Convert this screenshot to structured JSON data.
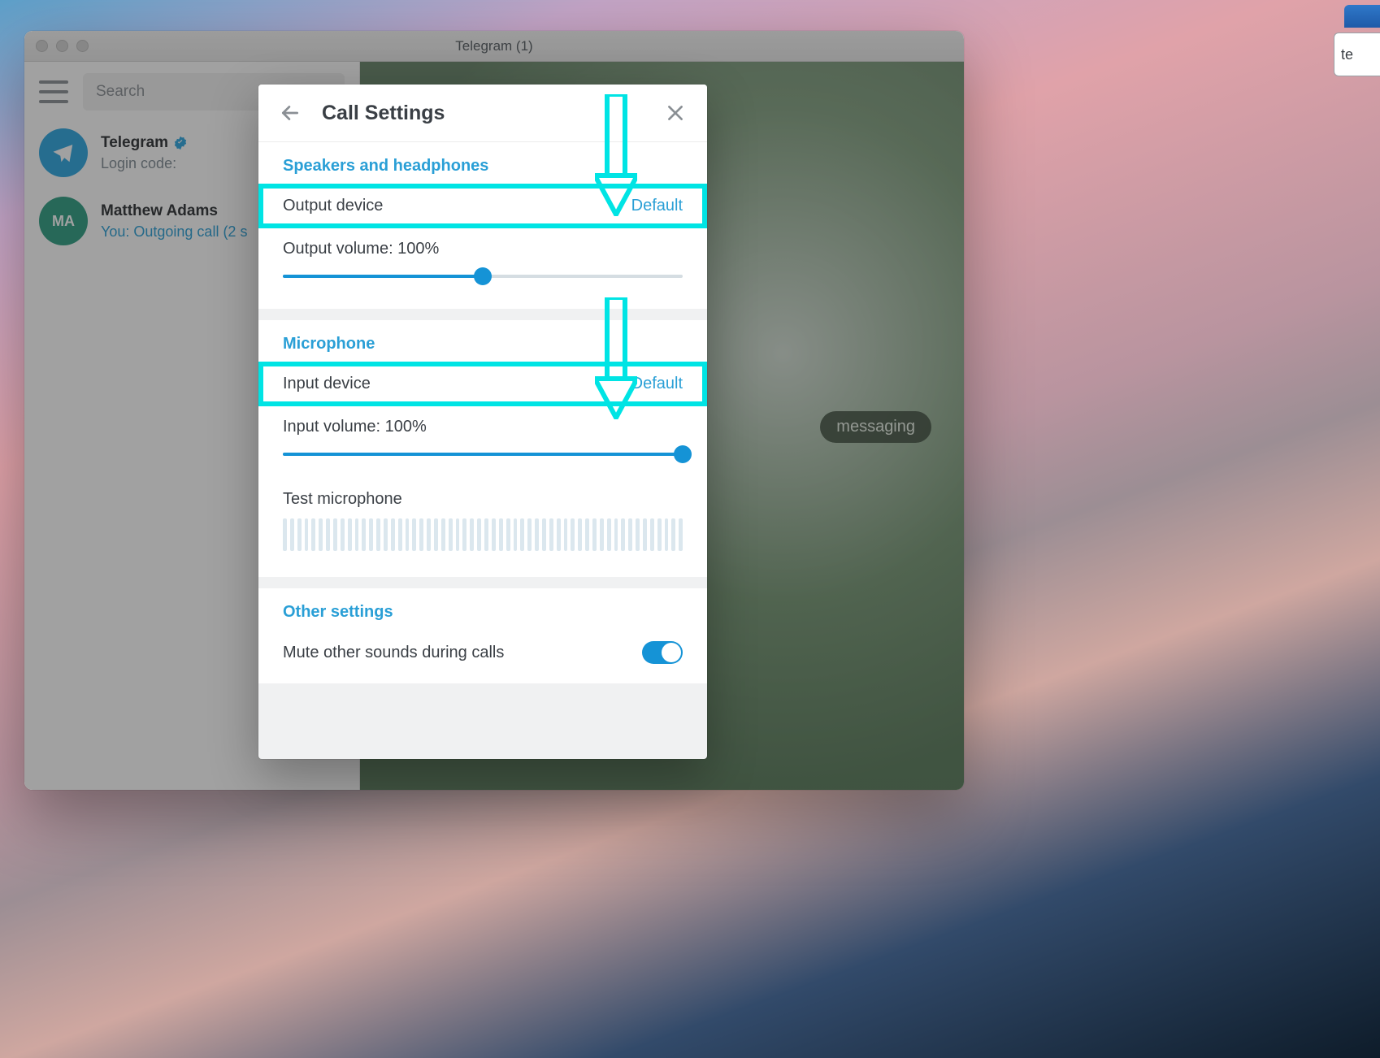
{
  "window": {
    "title": "Telegram (1)"
  },
  "search": {
    "placeholder": "Search"
  },
  "chats": [
    {
      "name": "Telegram",
      "preview": "Login code:",
      "verified": true,
      "avatar_type": "tg",
      "avatar_initials": ""
    },
    {
      "name": "Matthew Adams",
      "preview": "You: Outgoing call (2 s",
      "verified": false,
      "avatar_type": "ma",
      "avatar_initials": "MA",
      "preview_accent": true
    }
  ],
  "chat_bg_pill": "messaging",
  "dialog": {
    "title": "Call Settings",
    "sections": {
      "speakers": {
        "heading": "Speakers and headphones",
        "output_device_label": "Output device",
        "output_device_value": "Default",
        "output_volume_label": "Output volume: 100%",
        "output_volume_percent": 50
      },
      "microphone": {
        "heading": "Microphone",
        "input_device_label": "Input device",
        "input_device_value": "Default",
        "input_volume_label": "Input volume: 100%",
        "input_volume_percent": 100,
        "test_label": "Test microphone"
      },
      "other": {
        "heading": "Other settings",
        "mute_label": "Mute other sounds during calls",
        "mute_on": true
      }
    }
  },
  "web_tab_text": "te"
}
